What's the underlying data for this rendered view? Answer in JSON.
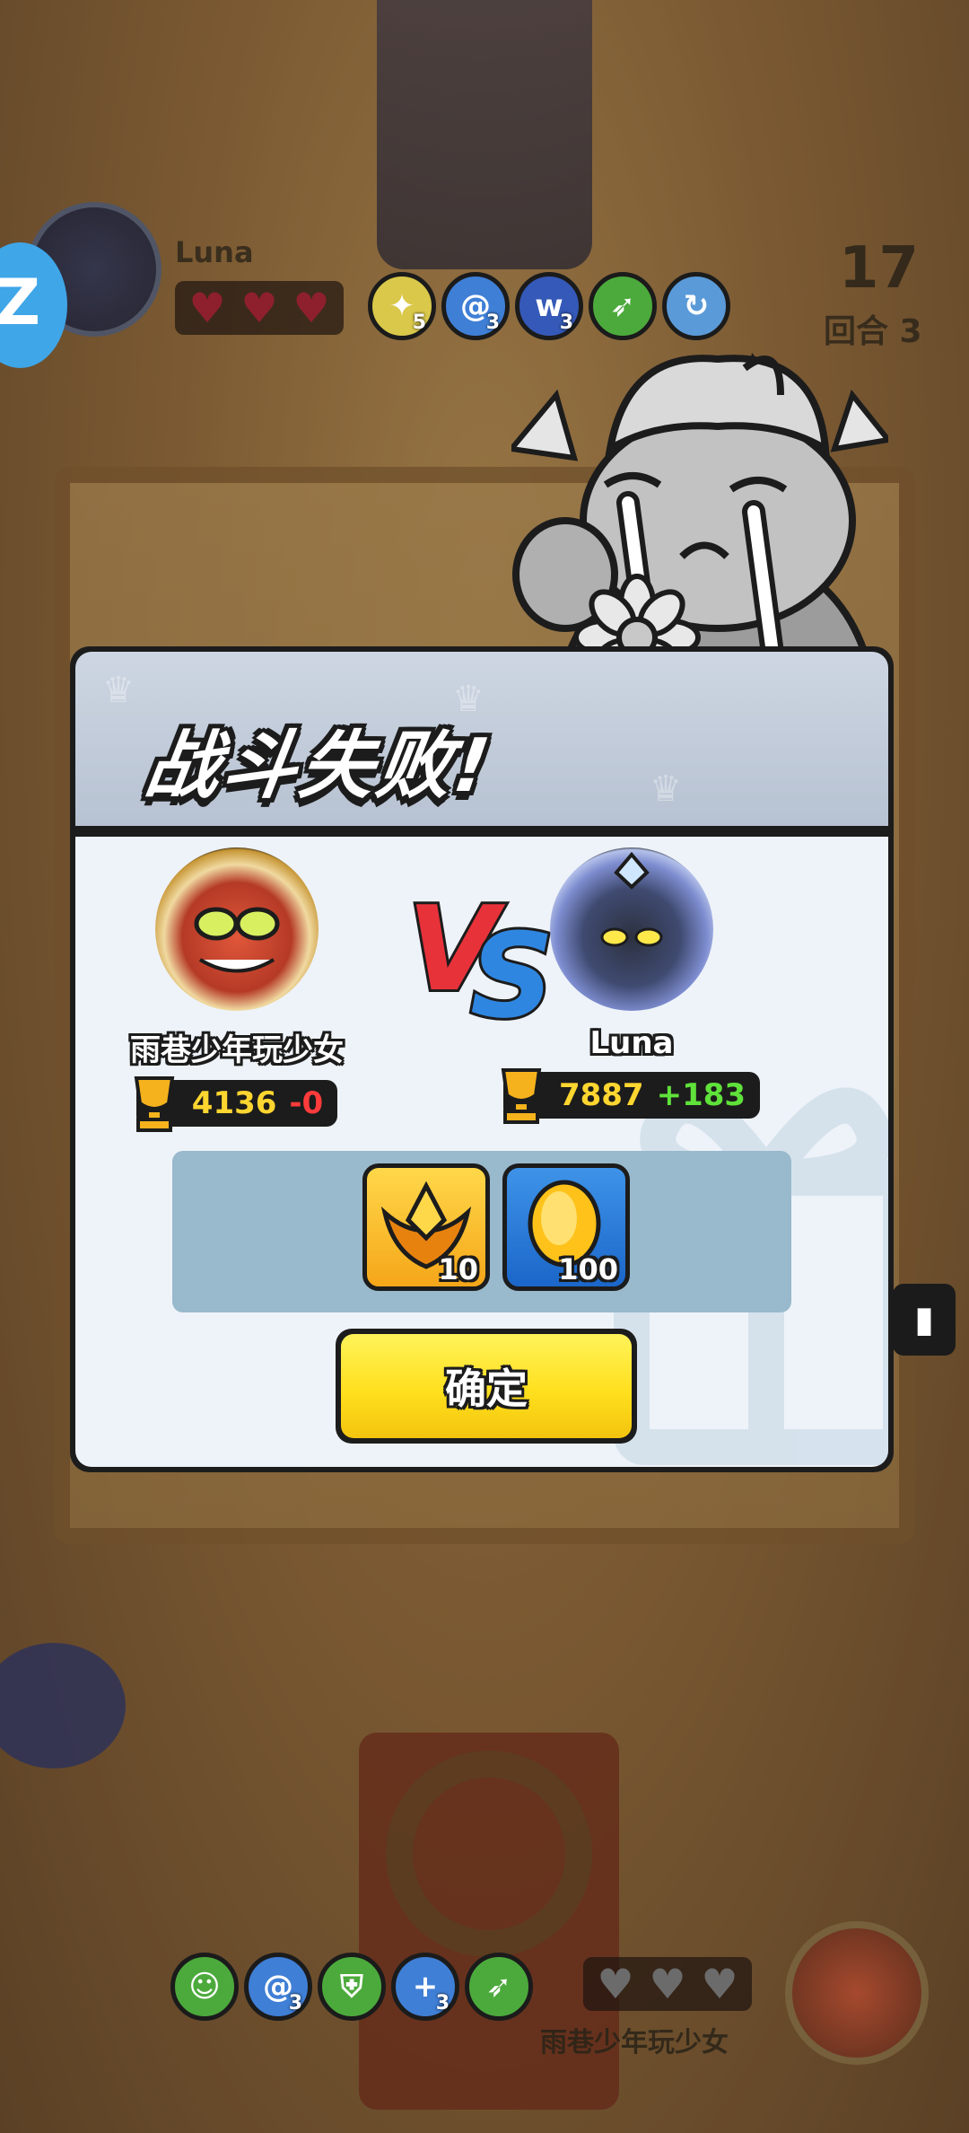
{
  "hud_top": {
    "opponent_name": "Luna",
    "hearts": [
      "heart",
      "heart",
      "heart"
    ],
    "skills": [
      {
        "icon": "boost-icon",
        "count": "5",
        "color": "#d9c84a"
      },
      {
        "icon": "swirl-icon",
        "count": "3",
        "color": "#3f7fd6"
      },
      {
        "icon": "claw-icon",
        "count": "3",
        "color": "#3559b8"
      },
      {
        "icon": "arrow-icon",
        "count": "",
        "color": "#4caa3c"
      },
      {
        "icon": "spin-icon",
        "count": "",
        "color": "#5b9ad8"
      }
    ],
    "turn_number": "17",
    "turn_label": "回合 3",
    "side_tab_glyph": "Z"
  },
  "dialog": {
    "title": "战斗失败!",
    "left_player": {
      "name": "雨巷少年玩少女",
      "trophies": "4136",
      "delta": "-0"
    },
    "right_player": {
      "name": "Luna",
      "trophies": "7887",
      "delta": "+183"
    },
    "vs_text": "VS",
    "rewards": [
      {
        "icon": "winged-badge-icon",
        "count": "10"
      },
      {
        "icon": "gold-coin-icon",
        "count": "100"
      }
    ],
    "confirm_label": "确定"
  },
  "hud_bottom": {
    "player_name": "雨巷少年玩少女",
    "hearts": [
      "heart",
      "heart",
      "heart"
    ],
    "skills": [
      {
        "icon": "yolo-icon",
        "count": "",
        "color": "#4caa3c"
      },
      {
        "icon": "swirl-icon",
        "count": "3",
        "color": "#3f7fd6"
      },
      {
        "icon": "shield-icon",
        "count": "",
        "color": "#4caa3c"
      },
      {
        "icon": "plus-icon",
        "count": "3",
        "color": "#3f7fd6"
      },
      {
        "icon": "arrow-icon",
        "count": "",
        "color": "#4caa3c"
      }
    ]
  },
  "colors": {
    "confirm_yellow": "#ffe01e",
    "loss_red": "#ff3b3b",
    "gain_green": "#5fe23a",
    "trophy_gold": "#ffd630"
  }
}
